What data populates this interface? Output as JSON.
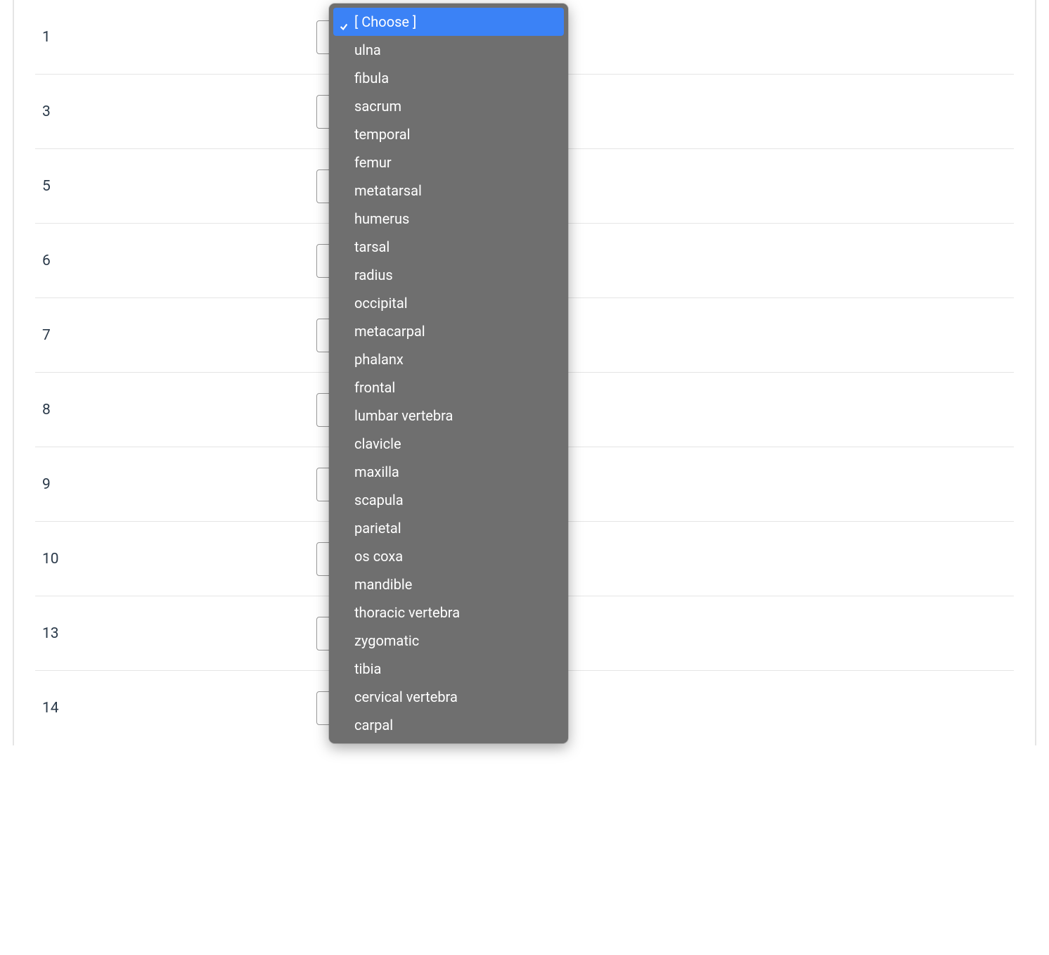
{
  "choose_placeholder": "[ Choose ]",
  "rows": [
    {
      "label": "1"
    },
    {
      "label": "3"
    },
    {
      "label": "5"
    },
    {
      "label": "6"
    },
    {
      "label": "7"
    },
    {
      "label": "8"
    },
    {
      "label": "9"
    },
    {
      "label": "10"
    },
    {
      "label": "13"
    },
    {
      "label": "14"
    }
  ],
  "dropdown": {
    "selected": "[ Choose ]",
    "options": [
      "[ Choose ]",
      "ulna",
      "fibula",
      "sacrum",
      "temporal",
      "femur",
      "metatarsal",
      "humerus",
      "tarsal",
      "radius",
      "occipital",
      "metacarpal",
      "phalanx",
      "frontal",
      "lumbar vertebra",
      "clavicle",
      "maxilla",
      "scapula",
      "parietal",
      "os coxa",
      "mandible",
      "thoracic vertebra",
      "zygomatic",
      "tibia",
      "cervical vertebra",
      "carpal"
    ]
  }
}
